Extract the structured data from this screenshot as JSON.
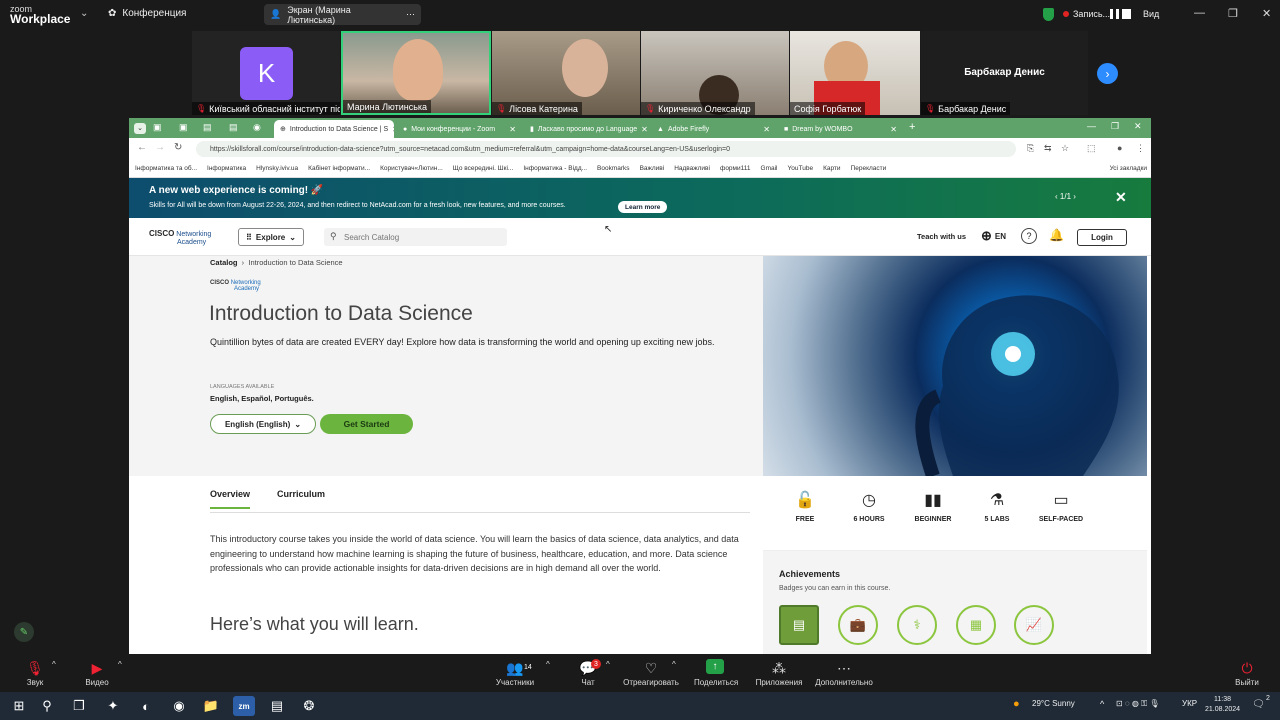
{
  "zoom": {
    "logo_top": "zoom",
    "logo_bottom": "Workplace",
    "conference": "Конференция",
    "share_label": "Экран (Марина Лютинська)",
    "recording": "Запись...",
    "view": "Вид",
    "participants": [
      {
        "name": "Київський обласний інститут піс...",
        "initial": "K",
        "color": "#8b5cf6"
      },
      {
        "name": "Марина Лютинська"
      },
      {
        "name": "Лісова Катерина"
      },
      {
        "name": "Кириченко Олександр"
      },
      {
        "name": "Софія Горбатюк"
      },
      {
        "name": "Барбакар Денис",
        "center": "Барбакар Денис"
      }
    ],
    "toolbar": {
      "audio": "Звук",
      "video": "Видео",
      "participants": "Участники",
      "participants_count": "14",
      "chat": "Чат",
      "chat_badge": "3",
      "react": "Отреагировать",
      "share": "Поделиться",
      "apps": "Приложения",
      "more": "Дополнительно",
      "leave": "Выйти"
    }
  },
  "browser": {
    "tabs": [
      {
        "label": "Introduction to Data Science | S"
      },
      {
        "label": "Мои конференции - Zoom"
      },
      {
        "label": "Ласкаво просимо до Language"
      },
      {
        "label": "Adobe Firefly"
      },
      {
        "label": "Dream by WOMBO"
      }
    ],
    "url": "https://skillsforall.com/course/introduction-data-science?utm_source=netacad.com&utm_medium=referral&utm_campaign=home-data&courseLang=en-US&userlogin=0",
    "bookmarks": [
      "Інформатика та об...",
      "Інформатика",
      "Hlynsky.iviv.ua",
      "Кабінет інформати...",
      "Користувач«Лютин...",
      "Що всередині. Шкі...",
      "Інформатика - Відд...",
      "Bookmarks",
      "Важливі",
      "Надважливі",
      "форми111",
      "Gmail",
      "YouTube",
      "Карти",
      "Перекласти",
      "Усі закладки"
    ]
  },
  "site": {
    "banner": {
      "title": "A new web experience is coming! 🚀",
      "text": "Skills for All will be down from August 22-26, 2024, and then redirect to NetAcad.com for a fresh look, new features, and more courses.",
      "learn_more": "Learn more",
      "pager": "1/1"
    },
    "nav": {
      "brand_top": "Networking",
      "brand_bottom": "Academy",
      "cisco": "CISCO",
      "explore": "Explore",
      "search_placeholder": "Search Catalog",
      "teach": "Teach with us",
      "lang": "EN",
      "login": "Login"
    },
    "breadcrumb": {
      "root": "Catalog",
      "current": "Introduction to Data Science"
    },
    "hero": {
      "logo_top": "Networking",
      "logo_bottom": "Academy",
      "logo_cisco": "CISCO",
      "title": "Introduction to Data Science",
      "desc": "Quintillion bytes of data are created EVERY day! Explore how data is transforming the world and opening up exciting new jobs.",
      "lang_label": "LANGUAGES AVAILABLE",
      "languages": "English, Español, Português.",
      "select": "English (English)",
      "cta": "Get Started"
    },
    "tabs": {
      "overview": "Overview",
      "curriculum": "Curriculum"
    },
    "body": "This introductory course takes you inside the world of data science. You will learn the basics of data science, data analytics, and data engineering to understand how machine learning is shaping the future of business, healthcare, education, and more. Data science professionals who can provide actionable insights for data-driven decisions are in high demand all over the world.",
    "learn_heading": "Here’s what you will learn.",
    "stats": [
      {
        "label": "FREE"
      },
      {
        "label": "6 HOURS"
      },
      {
        "label": "BEGINNER"
      },
      {
        "label": "5 LABS"
      },
      {
        "label": "SELF-PACED"
      }
    ],
    "achievements": {
      "title": "Achievements",
      "sub": "Badges you can earn in this course."
    }
  },
  "taskbar": {
    "weather": "29°C  Sunny",
    "lang": "УКР",
    "time": "11:38",
    "date": "21.08.2024",
    "notif": "2"
  }
}
